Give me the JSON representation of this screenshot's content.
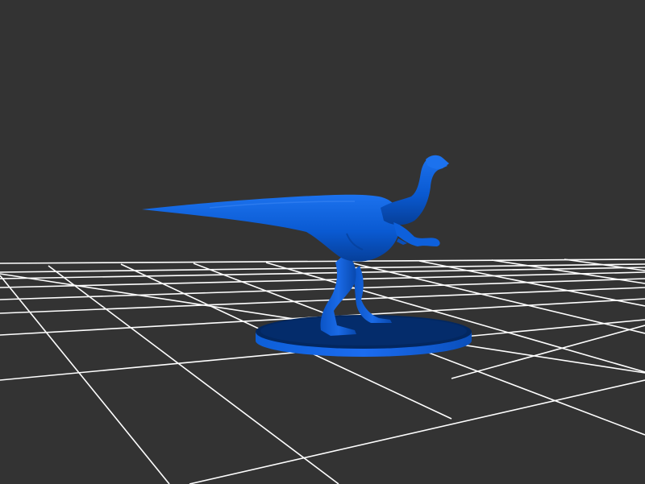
{
  "viewer": {
    "background_color": "#333333",
    "grid_color": "#ffffff",
    "model_color": "#0a5ad2",
    "model_name": "",
    "grid_visible": true
  }
}
